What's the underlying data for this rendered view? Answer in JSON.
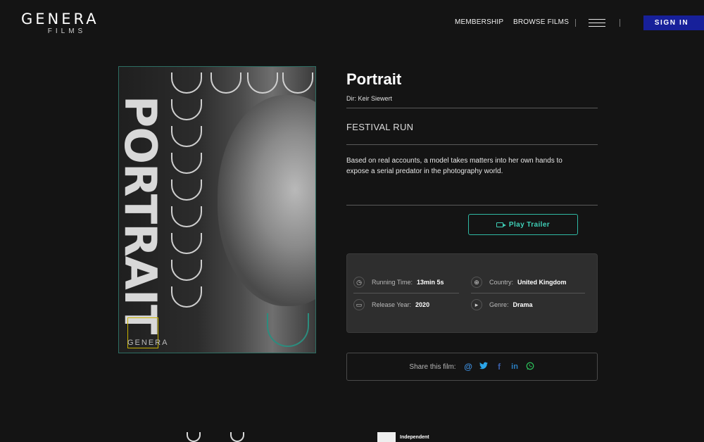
{
  "header": {
    "logo_main": "GENERA",
    "logo_sub": "FILMS",
    "nav": [
      "MEMBERSHIP",
      "BROWSE FILMS"
    ],
    "sign_in": "SIGN IN"
  },
  "poster": {
    "title_text": "PORTRAIT",
    "brand_text": "GENERA"
  },
  "film": {
    "title": "Portrait",
    "director": "Dir: Keir Siewert",
    "section": "FESTIVAL RUN",
    "synopsis": "Based on real accounts, a model takes matters into her own hands to expose a serial predator in the photography world.",
    "trailer_label": "Play Trailer"
  },
  "details": {
    "running_time_label": "Running Time:",
    "running_time": "13min 5s",
    "country_label": "Country:",
    "country": "United Kingdom",
    "release_year_label": "Release Year:",
    "release_year": "2020",
    "genre_label": "Genre:",
    "genre": "Drama"
  },
  "share": {
    "label": "Share this film:",
    "icons": [
      "email-at-icon",
      "twitter-icon",
      "facebook-icon",
      "linkedin-icon",
      "whatsapp-icon"
    ]
  },
  "footer": {
    "award_text": "Independent"
  },
  "colors": {
    "background": "#141414",
    "accent_teal": "#2fb8a3",
    "sign_in_blue": "#17209a",
    "panel": "#2e2e2e"
  }
}
